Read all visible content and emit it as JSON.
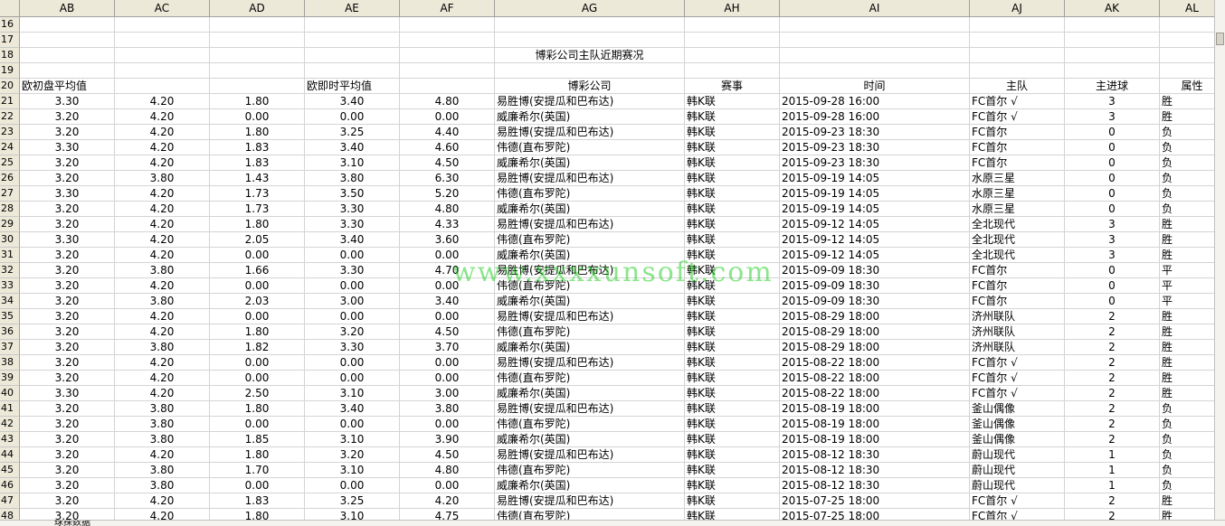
{
  "columns": [
    "AB",
    "AC",
    "AD",
    "AE",
    "AF",
    "AG",
    "AH",
    "AI",
    "AJ",
    "AK",
    "AL"
  ],
  "title_row": {
    "row": "18",
    "text": "博彩公司主队近期赛况"
  },
  "header_row": {
    "row": "20",
    "ab": "欧初盘平均值",
    "ae": "欧即时平均值",
    "ag": "博彩公司",
    "ah": "赛事",
    "ai": "时间",
    "aj": "主队",
    "ak": "主进球",
    "al": "属性"
  },
  "empty_rows": [
    "16",
    "17",
    "19"
  ],
  "data_rows": [
    {
      "r": "21",
      "ab": "3.30",
      "ac": "4.20",
      "ad": "1.80",
      "ae": "3.40",
      "af": "4.80",
      "ag": "易胜博(安提瓜和巴布达)",
      "ah": "韩K联",
      "ai": "2015-09-28 16:00",
      "aj": "FC首尔 √",
      "ak": "3",
      "al": "胜"
    },
    {
      "r": "22",
      "ab": "3.20",
      "ac": "4.20",
      "ad": "0.00",
      "ae": "0.00",
      "af": "0.00",
      "ag": "威廉希尔(英国)",
      "ah": "韩K联",
      "ai": "2015-09-28 16:00",
      "aj": "FC首尔 √",
      "ak": "3",
      "al": "胜"
    },
    {
      "r": "23",
      "ab": "3.20",
      "ac": "4.20",
      "ad": "1.80",
      "ae": "3.25",
      "af": "4.40",
      "ag": "易胜博(安提瓜和巴布达)",
      "ah": "韩K联",
      "ai": "2015-09-23 18:30",
      "aj": "FC首尔",
      "ak": "0",
      "al": "负"
    },
    {
      "r": "24",
      "ab": "3.30",
      "ac": "4.20",
      "ad": "1.83",
      "ae": "3.40",
      "af": "4.60",
      "ag": "伟德(直布罗陀)",
      "ah": "韩K联",
      "ai": "2015-09-23 18:30",
      "aj": "FC首尔",
      "ak": "0",
      "al": "负"
    },
    {
      "r": "25",
      "ab": "3.20",
      "ac": "4.20",
      "ad": "1.83",
      "ae": "3.10",
      "af": "4.50",
      "ag": "威廉希尔(英国)",
      "ah": "韩K联",
      "ai": "2015-09-23 18:30",
      "aj": "FC首尔",
      "ak": "0",
      "al": "负"
    },
    {
      "r": "26",
      "ab": "3.20",
      "ac": "3.80",
      "ad": "1.43",
      "ae": "3.80",
      "af": "6.30",
      "ag": "易胜博(安提瓜和巴布达)",
      "ah": "韩K联",
      "ai": "2015-09-19 14:05",
      "aj": "水原三星",
      "ak": "0",
      "al": "负"
    },
    {
      "r": "27",
      "ab": "3.30",
      "ac": "4.20",
      "ad": "1.73",
      "ae": "3.50",
      "af": "5.20",
      "ag": "伟德(直布罗陀)",
      "ah": "韩K联",
      "ai": "2015-09-19 14:05",
      "aj": "水原三星",
      "ak": "0",
      "al": "负"
    },
    {
      "r": "28",
      "ab": "3.20",
      "ac": "4.20",
      "ad": "1.73",
      "ae": "3.30",
      "af": "4.80",
      "ag": "威廉希尔(英国)",
      "ah": "韩K联",
      "ai": "2015-09-19 14:05",
      "aj": "水原三星",
      "ak": "0",
      "al": "负"
    },
    {
      "r": "29",
      "ab": "3.20",
      "ac": "4.20",
      "ad": "1.80",
      "ae": "3.30",
      "af": "4.33",
      "ag": "易胜博(安提瓜和巴布达)",
      "ah": "韩K联",
      "ai": "2015-09-12 14:05",
      "aj": "全北现代",
      "ak": "3",
      "al": "胜"
    },
    {
      "r": "30",
      "ab": "3.30",
      "ac": "4.20",
      "ad": "2.05",
      "ae": "3.40",
      "af": "3.60",
      "ag": "伟德(直布罗陀)",
      "ah": "韩K联",
      "ai": "2015-09-12 14:05",
      "aj": "全北现代",
      "ak": "3",
      "al": "胜"
    },
    {
      "r": "31",
      "ab": "3.20",
      "ac": "4.20",
      "ad": "0.00",
      "ae": "0.00",
      "af": "0.00",
      "ag": "威廉希尔(英国)",
      "ah": "韩K联",
      "ai": "2015-09-12 14:05",
      "aj": "全北现代",
      "ak": "3",
      "al": "胜"
    },
    {
      "r": "32",
      "ab": "3.20",
      "ac": "3.80",
      "ad": "1.66",
      "ae": "3.30",
      "af": "4.70",
      "ag": "易胜博(安提瓜和巴布达)",
      "ah": "韩K联",
      "ai": "2015-09-09 18:30",
      "aj": "FC首尔",
      "ak": "0",
      "al": "平"
    },
    {
      "r": "33",
      "ab": "3.20",
      "ac": "4.20",
      "ad": "0.00",
      "ae": "0.00",
      "af": "0.00",
      "ag": "伟德(直布罗陀)",
      "ah": "韩K联",
      "ai": "2015-09-09 18:30",
      "aj": "FC首尔",
      "ak": "0",
      "al": "平"
    },
    {
      "r": "34",
      "ab": "3.20",
      "ac": "3.80",
      "ad": "2.03",
      "ae": "3.00",
      "af": "3.40",
      "ag": "威廉希尔(英国)",
      "ah": "韩K联",
      "ai": "2015-09-09 18:30",
      "aj": "FC首尔",
      "ak": "0",
      "al": "平"
    },
    {
      "r": "35",
      "ab": "3.20",
      "ac": "4.20",
      "ad": "0.00",
      "ae": "0.00",
      "af": "0.00",
      "ag": "易胜博(安提瓜和巴布达)",
      "ah": "韩K联",
      "ai": "2015-08-29 18:00",
      "aj": "济州联队",
      "ak": "2",
      "al": "胜"
    },
    {
      "r": "36",
      "ab": "3.20",
      "ac": "4.20",
      "ad": "1.80",
      "ae": "3.20",
      "af": "4.50",
      "ag": "伟德(直布罗陀)",
      "ah": "韩K联",
      "ai": "2015-08-29 18:00",
      "aj": "济州联队",
      "ak": "2",
      "al": "胜"
    },
    {
      "r": "37",
      "ab": "3.20",
      "ac": "3.80",
      "ad": "1.82",
      "ae": "3.30",
      "af": "3.70",
      "ag": "威廉希尔(英国)",
      "ah": "韩K联",
      "ai": "2015-08-29 18:00",
      "aj": "济州联队",
      "ak": "2",
      "al": "胜"
    },
    {
      "r": "38",
      "ab": "3.20",
      "ac": "4.20",
      "ad": "0.00",
      "ae": "0.00",
      "af": "0.00",
      "ag": "易胜博(安提瓜和巴布达)",
      "ah": "韩K联",
      "ai": "2015-08-22 18:00",
      "aj": "FC首尔 √",
      "ak": "2",
      "al": "胜"
    },
    {
      "r": "39",
      "ab": "3.20",
      "ac": "4.20",
      "ad": "0.00",
      "ae": "0.00",
      "af": "0.00",
      "ag": "伟德(直布罗陀)",
      "ah": "韩K联",
      "ai": "2015-08-22 18:00",
      "aj": "FC首尔 √",
      "ak": "2",
      "al": "胜"
    },
    {
      "r": "40",
      "ab": "3.30",
      "ac": "4.20",
      "ad": "2.50",
      "ae": "3.10",
      "af": "3.00",
      "ag": "威廉希尔(英国)",
      "ah": "韩K联",
      "ai": "2015-08-22 18:00",
      "aj": "FC首尔 √",
      "ak": "2",
      "al": "胜"
    },
    {
      "r": "41",
      "ab": "3.20",
      "ac": "3.80",
      "ad": "1.80",
      "ae": "3.40",
      "af": "3.80",
      "ag": "易胜博(安提瓜和巴布达)",
      "ah": "韩K联",
      "ai": "2015-08-19 18:00",
      "aj": "釜山偶像",
      "ak": "2",
      "al": "负"
    },
    {
      "r": "42",
      "ab": "3.20",
      "ac": "3.80",
      "ad": "0.00",
      "ae": "0.00",
      "af": "0.00",
      "ag": "伟德(直布罗陀)",
      "ah": "韩K联",
      "ai": "2015-08-19 18:00",
      "aj": "釜山偶像",
      "ak": "2",
      "al": "负"
    },
    {
      "r": "43",
      "ab": "3.20",
      "ac": "3.80",
      "ad": "1.85",
      "ae": "3.10",
      "af": "3.90",
      "ag": "威廉希尔(英国)",
      "ah": "韩K联",
      "ai": "2015-08-19 18:00",
      "aj": "釜山偶像",
      "ak": "2",
      "al": "负"
    },
    {
      "r": "44",
      "ab": "3.20",
      "ac": "4.20",
      "ad": "1.80",
      "ae": "3.20",
      "af": "4.50",
      "ag": "易胜博(安提瓜和巴布达)",
      "ah": "韩K联",
      "ai": "2015-08-12 18:30",
      "aj": "蔚山现代",
      "ak": "1",
      "al": "负"
    },
    {
      "r": "45",
      "ab": "3.20",
      "ac": "3.80",
      "ad": "1.70",
      "ae": "3.10",
      "af": "4.80",
      "ag": "伟德(直布罗陀)",
      "ah": "韩K联",
      "ai": "2015-08-12 18:30",
      "aj": "蔚山现代",
      "ak": "1",
      "al": "负"
    },
    {
      "r": "46",
      "ab": "3.20",
      "ac": "3.80",
      "ad": "0.00",
      "ae": "0.00",
      "af": "0.00",
      "ag": "威廉希尔(英国)",
      "ah": "韩K联",
      "ai": "2015-08-12 18:30",
      "aj": "蔚山现代",
      "ak": "1",
      "al": "负"
    },
    {
      "r": "47",
      "ab": "3.20",
      "ac": "4.20",
      "ad": "1.83",
      "ae": "3.25",
      "af": "4.20",
      "ag": "易胜博(安提瓜和巴布达)",
      "ah": "韩K联",
      "ai": "2015-07-25 18:00",
      "aj": "FC首尔 √",
      "ak": "2",
      "al": "胜"
    },
    {
      "r": "48",
      "ab": "3.20",
      "ac": "4.20",
      "ad": "1.80",
      "ae": "3.10",
      "af": "4.75",
      "ag": "伟德(直布罗陀)",
      "ah": "韩K联",
      "ai": "2015-07-25 18:00",
      "aj": "FC首尔 √",
      "ak": "2",
      "al": "胜"
    }
  ],
  "watermark": "www.xxxxunsoft.com",
  "sheet_tab": "球探数据"
}
